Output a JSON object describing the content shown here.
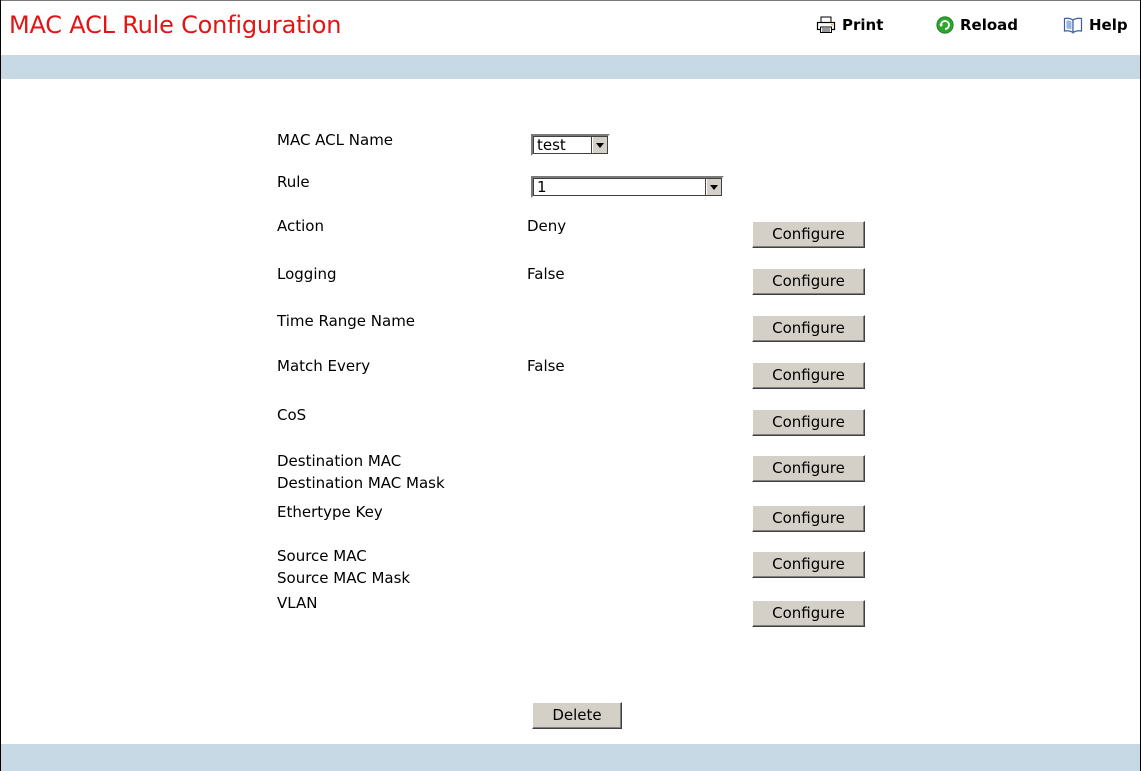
{
  "page": {
    "title": "MAC ACL Rule Configuration"
  },
  "toolbar": {
    "print_label": "Print",
    "reload_label": "Reload",
    "help_label": "Help"
  },
  "form": {
    "acl_name": {
      "label": "MAC ACL Name",
      "selected": "test"
    },
    "rule": {
      "label": "Rule",
      "selected": "1"
    },
    "rows": [
      {
        "label": "Action",
        "value": "Deny",
        "button": "Configure"
      },
      {
        "label": "Logging",
        "value": "False",
        "button": "Configure"
      },
      {
        "label": "Time Range Name",
        "value": "",
        "button": "Configure"
      },
      {
        "label": "Match Every",
        "value": "False",
        "button": "Configure"
      },
      {
        "label": "CoS",
        "value": "",
        "button": "Configure"
      },
      {
        "label": "Destination MAC",
        "label2": "Destination MAC Mask",
        "value": "",
        "button": "Configure"
      },
      {
        "label": "Ethertype Key",
        "value": "",
        "button": "Configure"
      },
      {
        "label": "Source MAC",
        "label2": "Source MAC Mask",
        "value": "",
        "button": "Configure"
      },
      {
        "label": "VLAN",
        "value": "",
        "button": "Configure"
      }
    ],
    "delete_label": "Delete"
  },
  "colors": {
    "title": "#e31414",
    "band": "#c6d9e4",
    "button_face": "#d4d0c8"
  },
  "icons": {
    "print": "printer-icon",
    "reload": "reload-icon",
    "help": "book-icon"
  }
}
